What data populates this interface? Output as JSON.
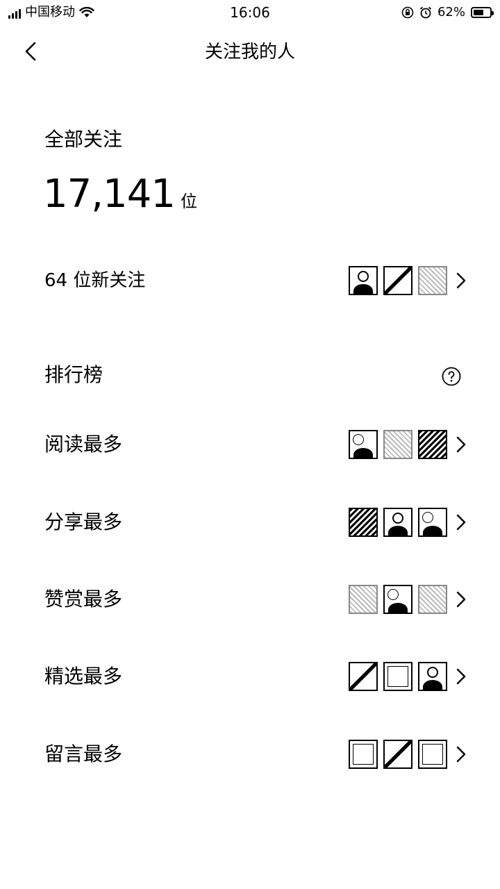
{
  "status_bar": {
    "carrier": "中国移动",
    "time": "16:06",
    "battery_percent": "62%",
    "battery_level": 0.62,
    "icons": [
      "signal-icon",
      "wifi-icon",
      "lock-rotation-icon",
      "alarm-icon",
      "battery-icon"
    ]
  },
  "nav": {
    "title": "关注我的人",
    "back_icon": "chevron-left-icon"
  },
  "summary": {
    "title": "全部关注",
    "count": "17,141",
    "unit": "位"
  },
  "new_followers": {
    "label": "64 位新关注",
    "avatars": 3
  },
  "ranking": {
    "title": "排行榜",
    "help_icon": "question-circle-icon",
    "items": [
      {
        "label": "阅读最多"
      },
      {
        "label": "分享最多"
      },
      {
        "label": "赞赏最多"
      },
      {
        "label": "精选最多"
      },
      {
        "label": "留言最多"
      }
    ]
  },
  "colors": {
    "background": "#ffffff",
    "text": "#000000"
  }
}
